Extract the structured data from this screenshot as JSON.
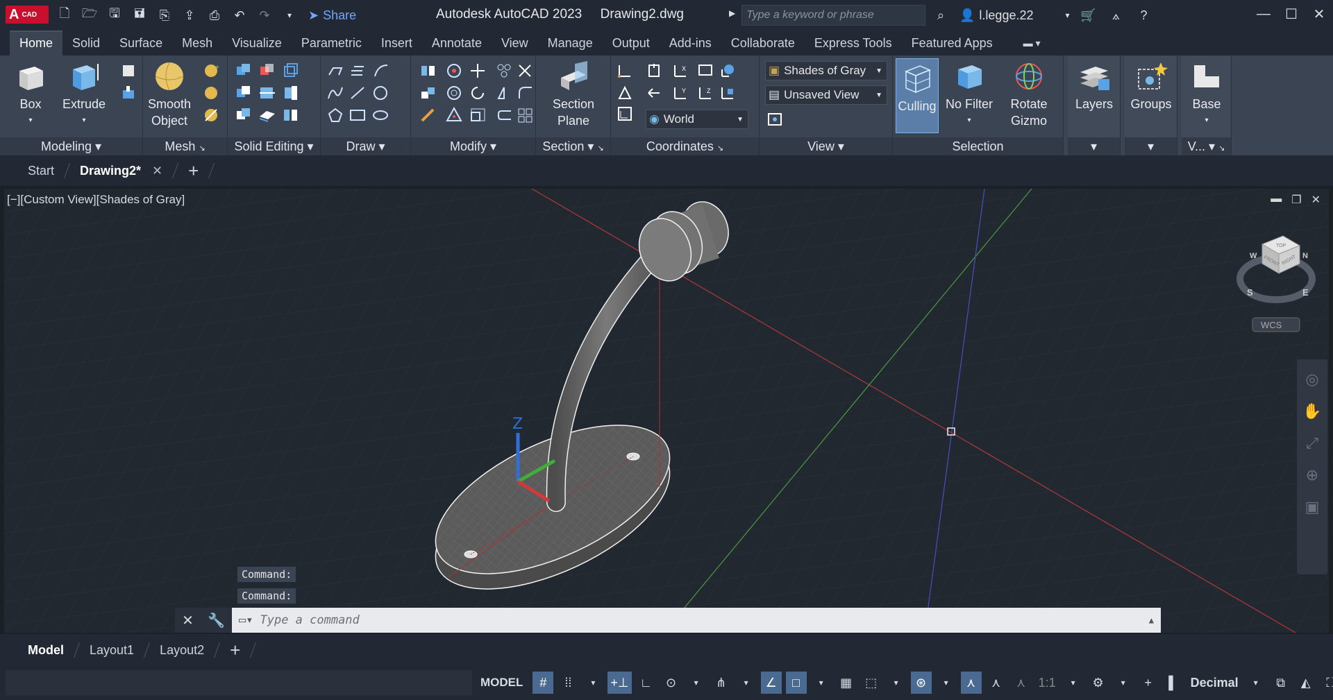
{
  "app": {
    "logo_letter": "A",
    "logo_sub": "CAD",
    "share_label": "Share",
    "title_app": "Autodesk AutoCAD 2023",
    "title_file": "Drawing2.dwg",
    "search_placeholder": "Type a keyword or phrase",
    "user_name": "l.legge.22",
    "accent": "#c8102e"
  },
  "ribbon_tabs": [
    "Home",
    "Solid",
    "Surface",
    "Mesh",
    "Visualize",
    "Parametric",
    "Insert",
    "Annotate",
    "View",
    "Manage",
    "Output",
    "Add-ins",
    "Collaborate",
    "Express Tools",
    "Featured Apps"
  ],
  "ribbon": {
    "modeling": {
      "title": "Modeling",
      "box": "Box",
      "extrude": "Extrude"
    },
    "mesh": {
      "title": "Mesh",
      "smooth_1": "Smooth",
      "smooth_2": "Object"
    },
    "solid_editing": {
      "title": "Solid Editing"
    },
    "draw": {
      "title": "Draw"
    },
    "modify": {
      "title": "Modify"
    },
    "section": {
      "title": "Section",
      "plane_1": "Section",
      "plane_2": "Plane"
    },
    "coordinates": {
      "title": "Coordinates",
      "ucs_value": "World"
    },
    "view": {
      "title": "View",
      "visual_style": "Shades of Gray",
      "named_view": "Unsaved View"
    },
    "selection": {
      "title": "Selection",
      "culling": "Culling",
      "no_filter": "No Filter",
      "rotate_1": "Rotate",
      "rotate_2": "Gizmo"
    },
    "layers": {
      "label": "Layers"
    },
    "groups": {
      "label": "Groups"
    },
    "base": {
      "label": "Base",
      "title": "V..."
    }
  },
  "doc_tabs": {
    "start": "Start",
    "drawing": "Drawing2*"
  },
  "viewport": {
    "label": "[−][Custom View][Shades of Gray]",
    "viewcube_wcs": "WCS",
    "viewcube_top": "TOP",
    "viewcube_front": "FRONT",
    "viewcube_right": "RIGHT",
    "compass_s": "S",
    "compass_e": "E",
    "compass_w": "W",
    "compass_n": "N",
    "ucs_z": "Z"
  },
  "command": {
    "history": [
      "Command:",
      "Command:"
    ],
    "placeholder": "Type a command"
  },
  "layout_tabs": [
    "Model",
    "Layout1",
    "Layout2"
  ],
  "status": {
    "model": "MODEL",
    "scale": "1:1",
    "units": "Decimal"
  }
}
